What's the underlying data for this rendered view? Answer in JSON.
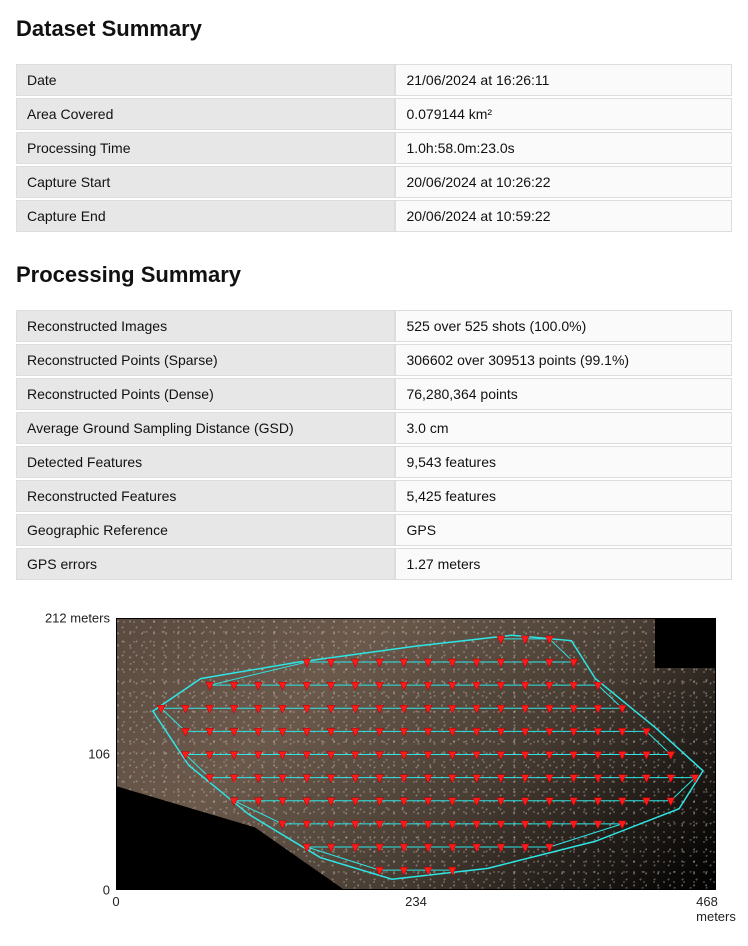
{
  "datasetSummary": {
    "heading": "Dataset Summary",
    "rows": [
      {
        "key": "Date",
        "val": "21/06/2024 at 16:26:11"
      },
      {
        "key": "Area Covered",
        "val": "0.079144 km²"
      },
      {
        "key": "Processing Time",
        "val": "1.0h:58.0m:23.0s"
      },
      {
        "key": "Capture Start",
        "val": "20/06/2024 at 10:26:22"
      },
      {
        "key": "Capture End",
        "val": "20/06/2024 at 10:59:22"
      }
    ]
  },
  "processingSummary": {
    "heading": "Processing Summary",
    "rows": [
      {
        "key": "Reconstructed Images",
        "val": "525 over 525 shots (100.0%)"
      },
      {
        "key": "Reconstructed Points (Sparse)",
        "val": "306602 over 309513 points (99.1%)"
      },
      {
        "key": "Reconstructed Points (Dense)",
        "val": "76,280,364 points"
      },
      {
        "key": "Average Ground Sampling Distance (GSD)",
        "val": "3.0 cm"
      },
      {
        "key": "Detected Features",
        "val": "9,543 features"
      },
      {
        "key": "Reconstructed Features",
        "val": "5,425 features"
      },
      {
        "key": "Geographic Reference",
        "val": "GPS"
      },
      {
        "key": "GPS errors",
        "val": "1.27 meters"
      }
    ]
  },
  "mapChart": {
    "yTicks": [
      {
        "label": "212 meters",
        "frac": 0.0
      },
      {
        "label": "106",
        "frac": 0.5
      },
      {
        "label": "0",
        "frac": 1.0
      }
    ],
    "xTicks": [
      {
        "label": "0",
        "frac": 0.0
      },
      {
        "label": "234",
        "frac": 0.5
      },
      {
        "label": "468 meters",
        "frac": 1.0
      }
    ],
    "polygon": [
      [
        0.06,
        0.34
      ],
      [
        0.14,
        0.22
      ],
      [
        0.3,
        0.16
      ],
      [
        0.5,
        0.1
      ],
      [
        0.66,
        0.06
      ],
      [
        0.76,
        0.08
      ],
      [
        0.8,
        0.22
      ],
      [
        0.9,
        0.4
      ],
      [
        0.98,
        0.56
      ],
      [
        0.94,
        0.7
      ],
      [
        0.8,
        0.82
      ],
      [
        0.62,
        0.92
      ],
      [
        0.46,
        0.96
      ],
      [
        0.34,
        0.88
      ],
      [
        0.22,
        0.72
      ],
      [
        0.12,
        0.54
      ]
    ],
    "markerGrid": {
      "cols": 24,
      "rows": 11
    }
  }
}
